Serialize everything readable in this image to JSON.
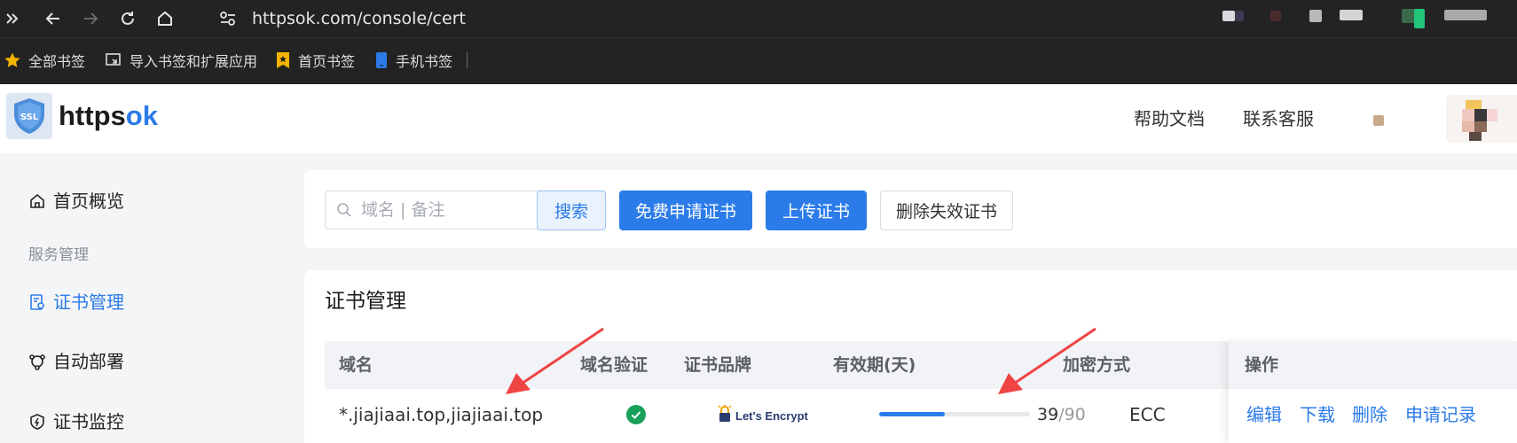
{
  "browser": {
    "url": "httpsok.com/console/cert",
    "bookmarks": [
      {
        "label": "全部书签",
        "icon": "star-icon"
      },
      {
        "label": "导入书签和扩展应用",
        "icon": "import-icon"
      },
      {
        "label": "首页书签",
        "icon": "bookmark-icon"
      },
      {
        "label": "手机书签",
        "icon": "mobile-icon"
      }
    ]
  },
  "header": {
    "logo_badge": "SSL",
    "logo_main": "https",
    "logo_accent": "ok",
    "nav": [
      "帮助文档",
      "联系客服"
    ]
  },
  "sidebar": {
    "overview": "首页概览",
    "group_label": "服务管理",
    "items": [
      "证书管理",
      "自动部署",
      "证书监控"
    ]
  },
  "search": {
    "placeholder": "域名 | 备注",
    "search_btn": "搜索",
    "apply_btn": "免费申请证书",
    "upload_btn": "上传证书",
    "delete_invalid_btn": "删除失效证书"
  },
  "cert_table": {
    "title": "证书管理",
    "columns": [
      "域名",
      "域名验证",
      "证书品牌",
      "有效期(天)",
      "加密方式",
      "操作"
    ],
    "rows": [
      {
        "domain": "*.jiajiaai.top,jiajiaai.top",
        "verified": true,
        "brand": "Let's Encrypt",
        "days_left": "39",
        "days_total": "/90",
        "progress_fraction": 0.433,
        "encryption": "ECC",
        "actions": [
          "编辑",
          "下载",
          "删除",
          "申请记录"
        ]
      }
    ]
  },
  "colors": {
    "accent": "#2b7be8",
    "success": "#18a058",
    "annotation_arrow": "#ef4444"
  }
}
